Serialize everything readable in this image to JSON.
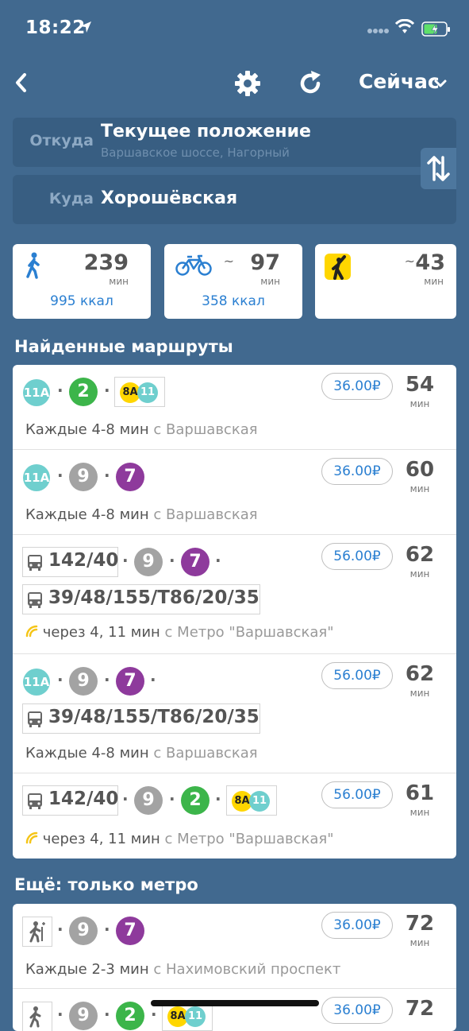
{
  "status_bar": {
    "time": "18:22"
  },
  "topbar": {
    "time_mode": "Сейчас"
  },
  "from": {
    "label": "Откуда",
    "value": "Текущее положение",
    "address": "Варшавское шоссе, Нагорный"
  },
  "to": {
    "label": "Куда",
    "value": "Хорошёвская"
  },
  "modes": {
    "walk": {
      "time": "239",
      "unit": "мин",
      "kcal": "995 ккал"
    },
    "bike": {
      "tilde": "~",
      "time": "97",
      "unit": "мин",
      "kcal": "358 ккал"
    },
    "taxi": {
      "tilde": "~",
      "time": "43",
      "unit": "мин"
    }
  },
  "found_title": "Найденные маршруты",
  "routes": [
    {
      "badges": [
        "11A",
        "2"
      ],
      "combo": [
        "8A",
        "11"
      ],
      "price": "36.00₽",
      "time": "54",
      "unit": "мин",
      "freq": "Каждые 4-8 мин",
      "from": "с Варшавская"
    },
    {
      "badges": [
        "11A",
        "9",
        "7"
      ],
      "price": "36.00₽",
      "time": "60",
      "unit": "мин",
      "freq": "Каждые 4-8 мин",
      "from": "с Варшавская"
    },
    {
      "bus1": "142/40",
      "badges": [
        "9",
        "7"
      ],
      "bus2": "39/48/155/Т86/20/35",
      "price": "56.00₽",
      "time": "62",
      "unit": "мин",
      "rt": "через 4, 11 мин",
      "from": "с Метро \"Варшавская\""
    },
    {
      "badges": [
        "11A",
        "9",
        "7"
      ],
      "bus2": "39/48/155/Т86/20/35",
      "price": "56.00₽",
      "time": "62",
      "unit": "мин",
      "freq": "Каждые 4-8 мин",
      "from": "с Варшавская"
    },
    {
      "bus1": "142/40",
      "badges": [
        "9",
        "2"
      ],
      "combo": [
        "8A",
        "11"
      ],
      "price": "56.00₽",
      "time": "61",
      "unit": "мин",
      "rt": "через 4, 11 мин",
      "from": "с Метро \"Варшавская\""
    }
  ],
  "metro_title": "Ещё: только метро",
  "metro_routes": [
    {
      "badges": [
        "9",
        "7"
      ],
      "price": "36.00₽",
      "time": "72",
      "unit": "мин",
      "freq": "Каждые 2-3 мин",
      "from": "с Нахимовский проспект"
    },
    {
      "badges": [
        "9",
        "2"
      ],
      "combo": [
        "8A",
        "11"
      ],
      "price": "36.00₽",
      "time": "72"
    }
  ],
  "colors": {
    "background": "#41698f",
    "line_11A": "#6fcfce",
    "line_2": "#3cb54a",
    "line_9": "#a3a3a3",
    "line_7": "#8e3a9c",
    "line_8A": "#ffd600",
    "accent": "#2a7fd1"
  }
}
